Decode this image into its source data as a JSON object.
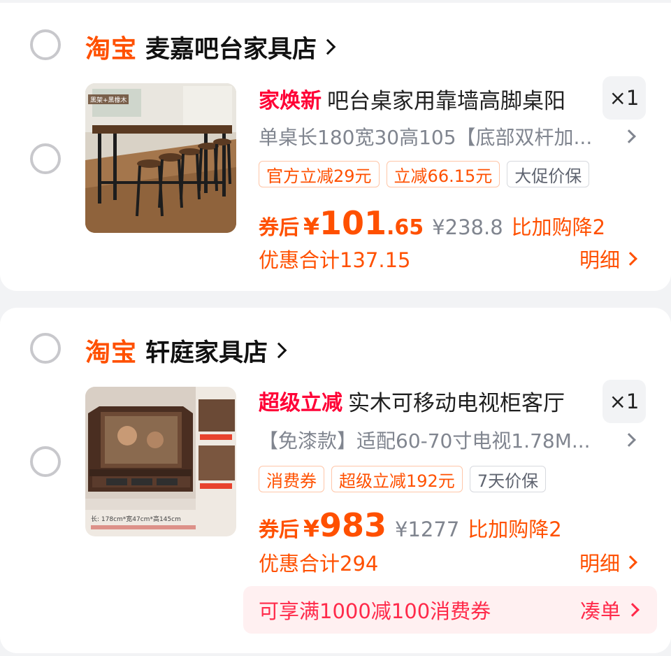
{
  "items": [
    {
      "shop": {
        "brand": "淘宝",
        "name": "麦嘉吧台家具店"
      },
      "thumb_label": "黑架+黑橡木",
      "title_tag": "家焕新",
      "title": "吧台桌家用靠墙高脚桌阳",
      "quantity": "×1",
      "spec": "单桌长180宽30高105【底部双杆加...",
      "badges": [
        {
          "text": "官方立减29元",
          "style": "orange"
        },
        {
          "text": "立减66.15元",
          "style": "orange"
        },
        {
          "text": "大促价保",
          "style": "gray"
        }
      ],
      "price": {
        "label": "券后",
        "yen": "¥",
        "int": "101",
        "dec": ".65",
        "original": "¥238.8",
        "drop": "比加购降2"
      },
      "discount_total": "优惠合计137.15",
      "detail": "明细"
    },
    {
      "shop": {
        "brand": "淘宝",
        "name": "轩庭家具店"
      },
      "thumb_label": "长: 178cm*宽47cm*高145cm",
      "title_tag": "超级立减",
      "title": "实木可移动电视柜客厅",
      "quantity": "×1",
      "spec": "【免漆款】适配60-70寸电视1.78M...",
      "badges": [
        {
          "text": "消费券",
          "style": "orange"
        },
        {
          "text": "超级立减192元",
          "style": "orange"
        },
        {
          "text": "7天价保",
          "style": "gray"
        }
      ],
      "price": {
        "label": "券后",
        "yen": "¥",
        "int": "983",
        "dec": "",
        "original": "¥1277",
        "drop": "比加购降2"
      },
      "discount_total": "优惠合计294",
      "detail": "明细",
      "promo": {
        "text": "可享满1000减100消费券",
        "cta": "凑单"
      }
    }
  ],
  "colors": {
    "accent": "#ff5000",
    "tag_red": "#ff0036",
    "promo_bg": "#fff0f1"
  }
}
